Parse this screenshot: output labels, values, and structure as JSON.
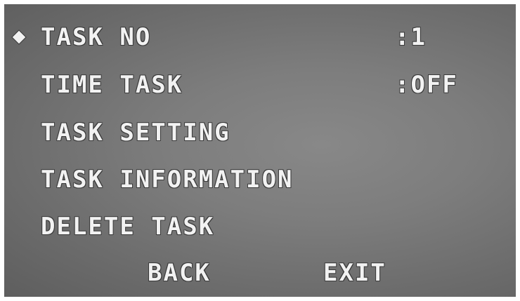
{
  "menu": {
    "selected_indicator_icon": "diamond-icon",
    "items": [
      {
        "label": "TASK NO",
        "value": ":1"
      },
      {
        "label": "TIME TASK",
        "value": ":OFF"
      },
      {
        "label": "TASK SETTING"
      },
      {
        "label": "TASK INFORMATION"
      },
      {
        "label": "DELETE TASK"
      }
    ]
  },
  "footer": {
    "back_label": "BACK",
    "exit_label": "EXIT"
  },
  "colors": {
    "text": "#f2f2f2",
    "background": "#7d7d7d"
  }
}
